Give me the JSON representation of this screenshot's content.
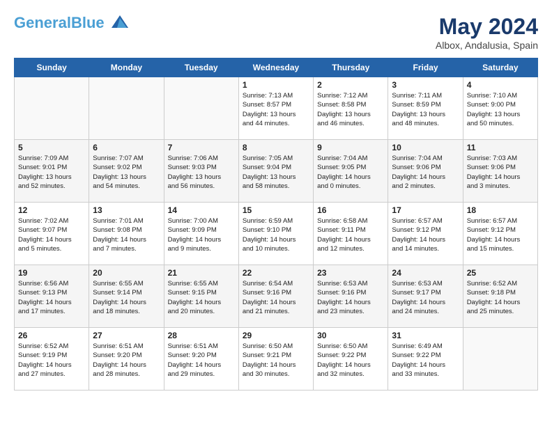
{
  "header": {
    "logo_line1": "General",
    "logo_line2": "Blue",
    "month_year": "May 2024",
    "location": "Albox, Andalusia, Spain"
  },
  "weekdays": [
    "Sunday",
    "Monday",
    "Tuesday",
    "Wednesday",
    "Thursday",
    "Friday",
    "Saturday"
  ],
  "weeks": [
    [
      {
        "day": "",
        "empty": true
      },
      {
        "day": "",
        "empty": true
      },
      {
        "day": "",
        "empty": true
      },
      {
        "day": "1",
        "lines": [
          "Sunrise: 7:13 AM",
          "Sunset: 8:57 PM",
          "Daylight: 13 hours",
          "and 44 minutes."
        ]
      },
      {
        "day": "2",
        "lines": [
          "Sunrise: 7:12 AM",
          "Sunset: 8:58 PM",
          "Daylight: 13 hours",
          "and 46 minutes."
        ]
      },
      {
        "day": "3",
        "lines": [
          "Sunrise: 7:11 AM",
          "Sunset: 8:59 PM",
          "Daylight: 13 hours",
          "and 48 minutes."
        ]
      },
      {
        "day": "4",
        "lines": [
          "Sunrise: 7:10 AM",
          "Sunset: 9:00 PM",
          "Daylight: 13 hours",
          "and 50 minutes."
        ]
      }
    ],
    [
      {
        "day": "5",
        "lines": [
          "Sunrise: 7:09 AM",
          "Sunset: 9:01 PM",
          "Daylight: 13 hours",
          "and 52 minutes."
        ]
      },
      {
        "day": "6",
        "lines": [
          "Sunrise: 7:07 AM",
          "Sunset: 9:02 PM",
          "Daylight: 13 hours",
          "and 54 minutes."
        ]
      },
      {
        "day": "7",
        "lines": [
          "Sunrise: 7:06 AM",
          "Sunset: 9:03 PM",
          "Daylight: 13 hours",
          "and 56 minutes."
        ]
      },
      {
        "day": "8",
        "lines": [
          "Sunrise: 7:05 AM",
          "Sunset: 9:04 PM",
          "Daylight: 13 hours",
          "and 58 minutes."
        ]
      },
      {
        "day": "9",
        "lines": [
          "Sunrise: 7:04 AM",
          "Sunset: 9:05 PM",
          "Daylight: 14 hours",
          "and 0 minutes."
        ]
      },
      {
        "day": "10",
        "lines": [
          "Sunrise: 7:04 AM",
          "Sunset: 9:06 PM",
          "Daylight: 14 hours",
          "and 2 minutes."
        ]
      },
      {
        "day": "11",
        "lines": [
          "Sunrise: 7:03 AM",
          "Sunset: 9:06 PM",
          "Daylight: 14 hours",
          "and 3 minutes."
        ]
      }
    ],
    [
      {
        "day": "12",
        "lines": [
          "Sunrise: 7:02 AM",
          "Sunset: 9:07 PM",
          "Daylight: 14 hours",
          "and 5 minutes."
        ]
      },
      {
        "day": "13",
        "lines": [
          "Sunrise: 7:01 AM",
          "Sunset: 9:08 PM",
          "Daylight: 14 hours",
          "and 7 minutes."
        ]
      },
      {
        "day": "14",
        "lines": [
          "Sunrise: 7:00 AM",
          "Sunset: 9:09 PM",
          "Daylight: 14 hours",
          "and 9 minutes."
        ]
      },
      {
        "day": "15",
        "lines": [
          "Sunrise: 6:59 AM",
          "Sunset: 9:10 PM",
          "Daylight: 14 hours",
          "and 10 minutes."
        ]
      },
      {
        "day": "16",
        "lines": [
          "Sunrise: 6:58 AM",
          "Sunset: 9:11 PM",
          "Daylight: 14 hours",
          "and 12 minutes."
        ]
      },
      {
        "day": "17",
        "lines": [
          "Sunrise: 6:57 AM",
          "Sunset: 9:12 PM",
          "Daylight: 14 hours",
          "and 14 minutes."
        ]
      },
      {
        "day": "18",
        "lines": [
          "Sunrise: 6:57 AM",
          "Sunset: 9:12 PM",
          "Daylight: 14 hours",
          "and 15 minutes."
        ]
      }
    ],
    [
      {
        "day": "19",
        "lines": [
          "Sunrise: 6:56 AM",
          "Sunset: 9:13 PM",
          "Daylight: 14 hours",
          "and 17 minutes."
        ]
      },
      {
        "day": "20",
        "lines": [
          "Sunrise: 6:55 AM",
          "Sunset: 9:14 PM",
          "Daylight: 14 hours",
          "and 18 minutes."
        ]
      },
      {
        "day": "21",
        "lines": [
          "Sunrise: 6:55 AM",
          "Sunset: 9:15 PM",
          "Daylight: 14 hours",
          "and 20 minutes."
        ]
      },
      {
        "day": "22",
        "lines": [
          "Sunrise: 6:54 AM",
          "Sunset: 9:16 PM",
          "Daylight: 14 hours",
          "and 21 minutes."
        ]
      },
      {
        "day": "23",
        "lines": [
          "Sunrise: 6:53 AM",
          "Sunset: 9:16 PM",
          "Daylight: 14 hours",
          "and 23 minutes."
        ]
      },
      {
        "day": "24",
        "lines": [
          "Sunrise: 6:53 AM",
          "Sunset: 9:17 PM",
          "Daylight: 14 hours",
          "and 24 minutes."
        ]
      },
      {
        "day": "25",
        "lines": [
          "Sunrise: 6:52 AM",
          "Sunset: 9:18 PM",
          "Daylight: 14 hours",
          "and 25 minutes."
        ]
      }
    ],
    [
      {
        "day": "26",
        "lines": [
          "Sunrise: 6:52 AM",
          "Sunset: 9:19 PM",
          "Daylight: 14 hours",
          "and 27 minutes."
        ]
      },
      {
        "day": "27",
        "lines": [
          "Sunrise: 6:51 AM",
          "Sunset: 9:20 PM",
          "Daylight: 14 hours",
          "and 28 minutes."
        ]
      },
      {
        "day": "28",
        "lines": [
          "Sunrise: 6:51 AM",
          "Sunset: 9:20 PM",
          "Daylight: 14 hours",
          "and 29 minutes."
        ]
      },
      {
        "day": "29",
        "lines": [
          "Sunrise: 6:50 AM",
          "Sunset: 9:21 PM",
          "Daylight: 14 hours",
          "and 30 minutes."
        ]
      },
      {
        "day": "30",
        "lines": [
          "Sunrise: 6:50 AM",
          "Sunset: 9:22 PM",
          "Daylight: 14 hours",
          "and 32 minutes."
        ]
      },
      {
        "day": "31",
        "lines": [
          "Sunrise: 6:49 AM",
          "Sunset: 9:22 PM",
          "Daylight: 14 hours",
          "and 33 minutes."
        ]
      },
      {
        "day": "",
        "empty": true
      }
    ]
  ]
}
